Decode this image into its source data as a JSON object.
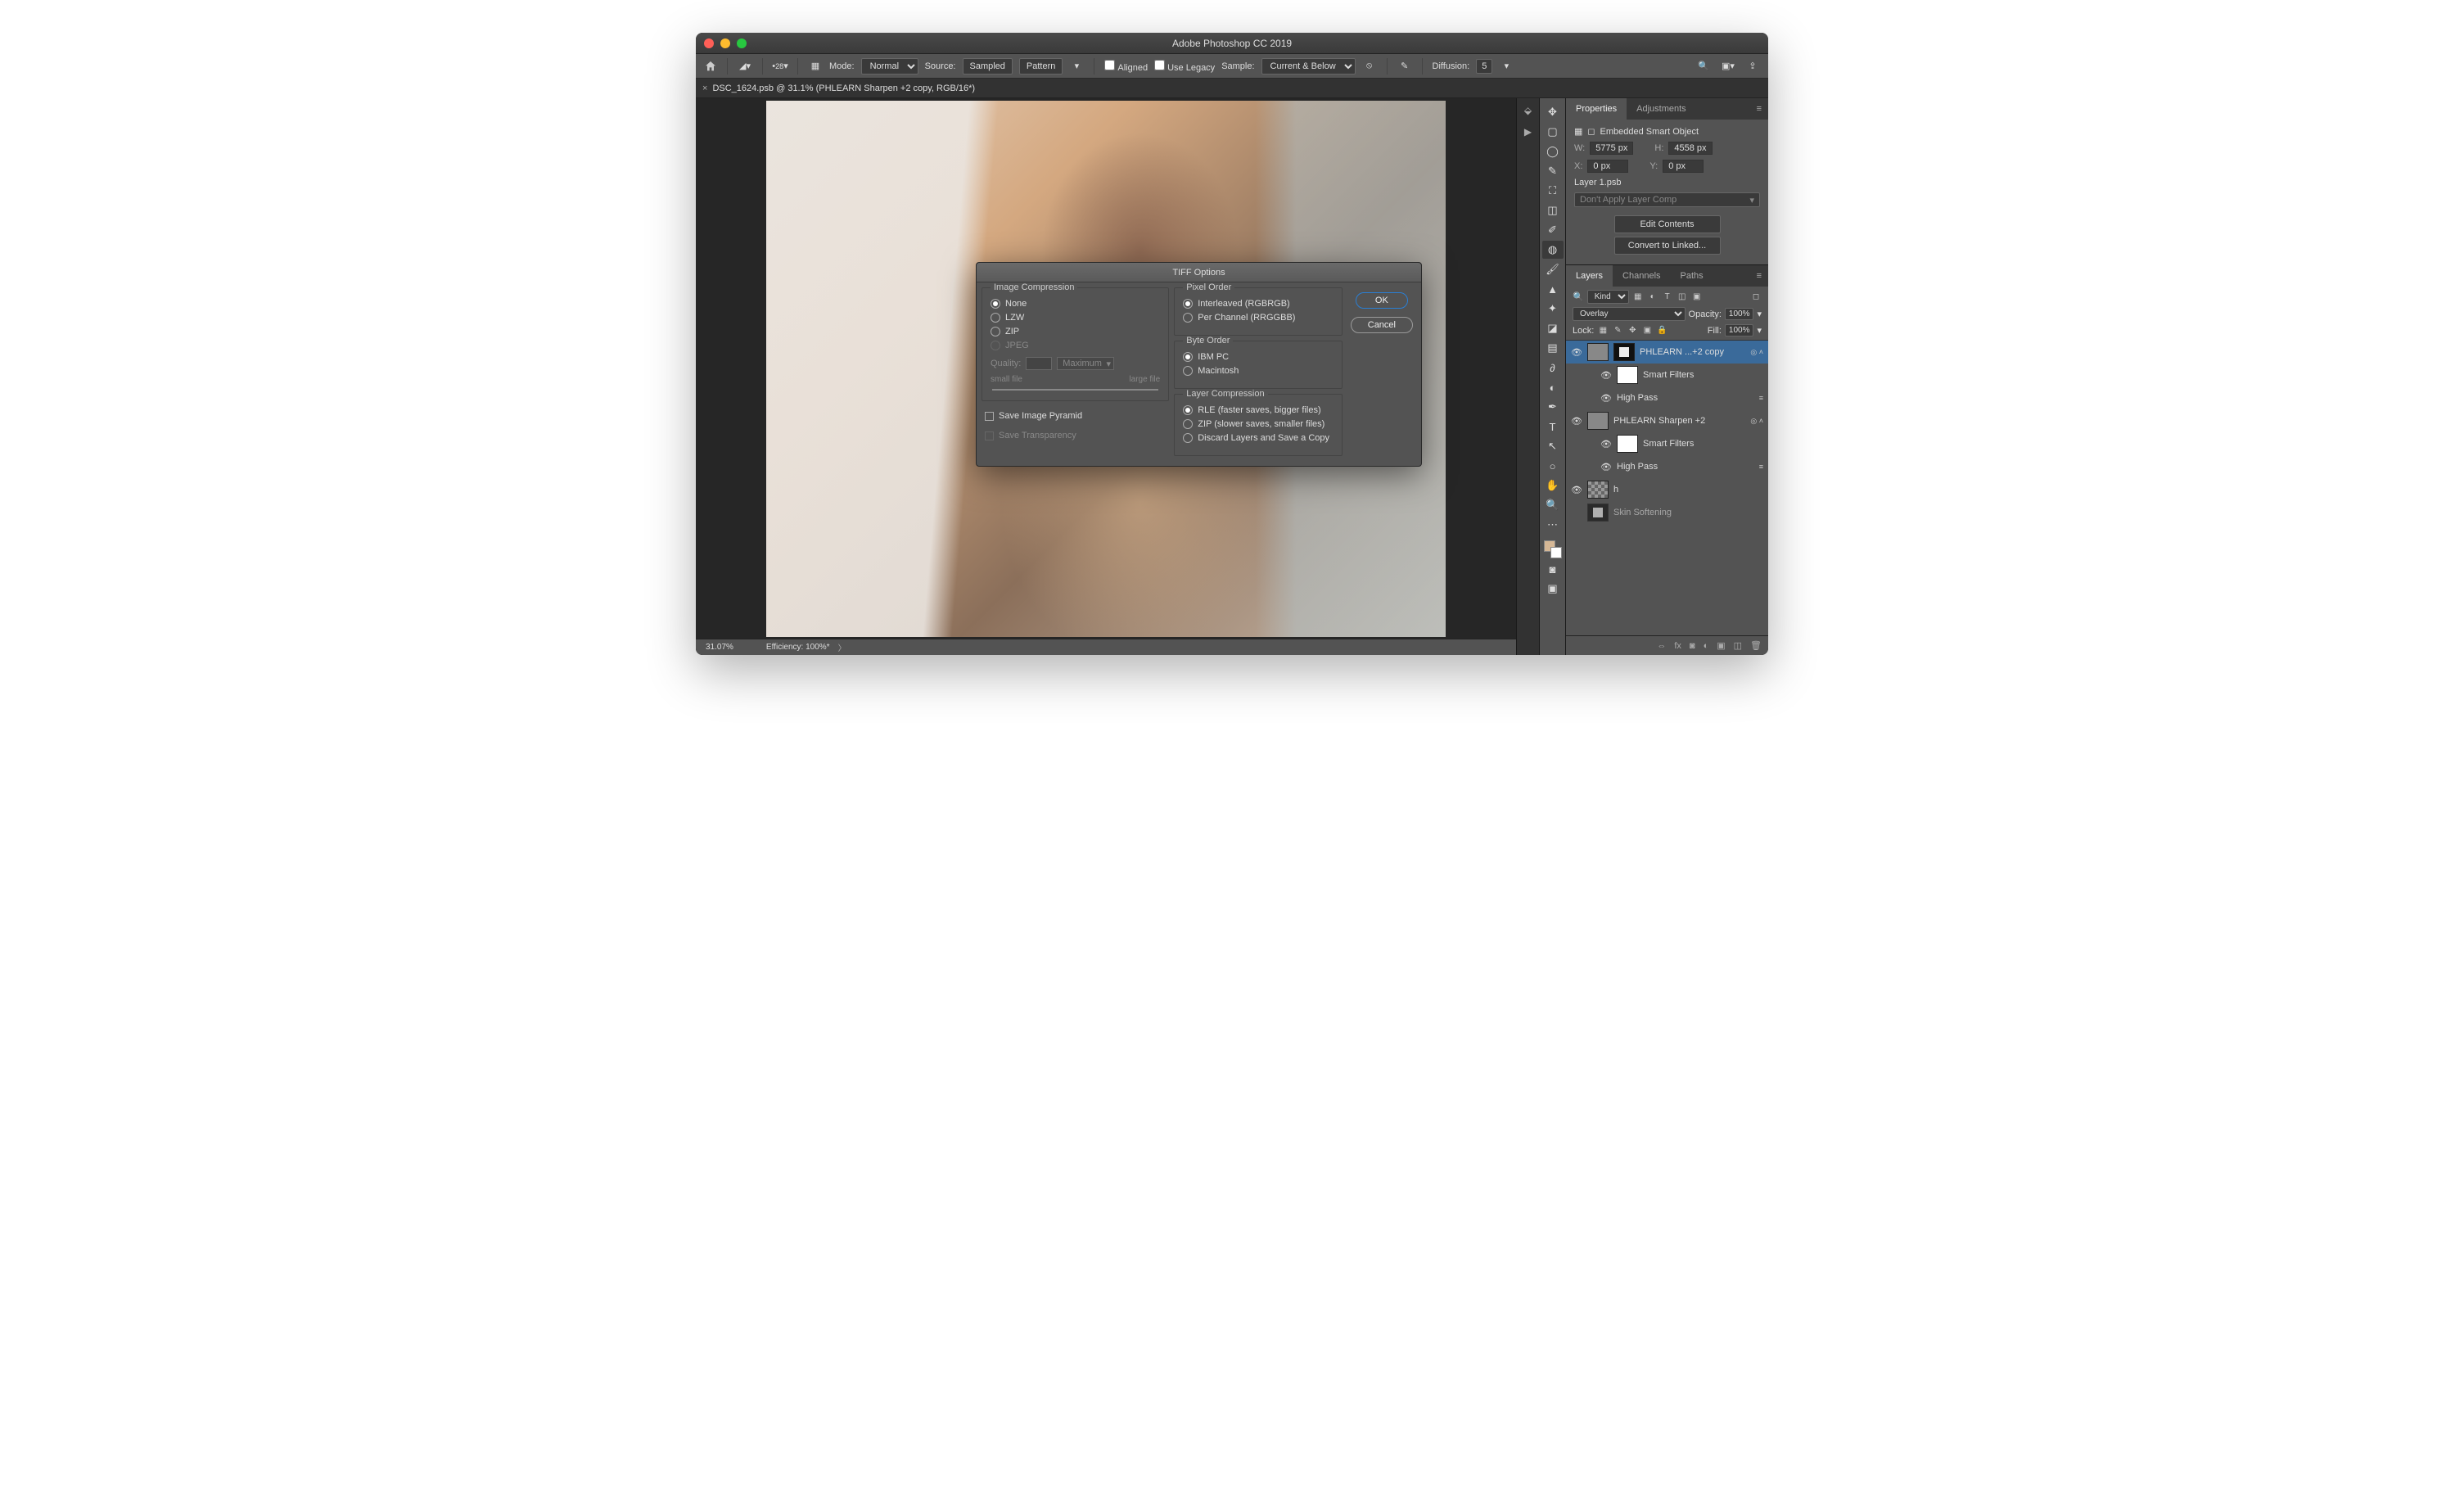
{
  "title": "Adobe Photoshop CC 2019",
  "options_bar": {
    "brush_size": "28",
    "mode_label": "Mode:",
    "mode_value": "Normal",
    "source_label": "Source:",
    "sampled": "Sampled",
    "pattern": "Pattern",
    "aligned": "Aligned",
    "use_legacy": "Use Legacy",
    "sample_label": "Sample:",
    "sample_value": "Current & Below",
    "diffusion_label": "Diffusion:",
    "diffusion_value": "5"
  },
  "tab": {
    "name": "DSC_1624.psb @ 31.1% (PHLEARN Sharpen +2 copy, RGB/16*)"
  },
  "status": {
    "zoom": "31.07%",
    "efficiency": "Efficiency: 100%*"
  },
  "properties": {
    "tab_properties": "Properties",
    "tab_adjustments": "Adjustments",
    "type": "Embedded Smart Object",
    "w_label": "W:",
    "w_val": "5775 px",
    "h_label": "H:",
    "h_val": "4558 px",
    "x_label": "X:",
    "x_val": "0 px",
    "y_label": "Y:",
    "y_val": "0 px",
    "source": "Layer 1.psb",
    "comp": "Don't Apply Layer Comp",
    "edit": "Edit Contents",
    "convert": "Convert to Linked..."
  },
  "layers_panel": {
    "tab_layers": "Layers",
    "tab_channels": "Channels",
    "tab_paths": "Paths",
    "kind": "Kind",
    "blend": "Overlay",
    "opacity_label": "Opacity:",
    "opacity_value": "100%",
    "lock_label": "Lock:",
    "fill_label": "Fill:",
    "fill_value": "100%",
    "layers": [
      {
        "name": "PHLEARN ...+2 copy",
        "sel": true
      },
      {
        "name": "Smart Filters",
        "indent": true
      },
      {
        "name": "High Pass",
        "indent": true,
        "sub": true
      },
      {
        "name": "PHLEARN Sharpen +2"
      },
      {
        "name": "Smart Filters",
        "indent": true
      },
      {
        "name": "High Pass",
        "indent": true,
        "sub": true
      },
      {
        "name": "h",
        "checker": true
      },
      {
        "name": "Skin Softening",
        "cut": true
      }
    ]
  },
  "dialog": {
    "title": "TIFF Options",
    "image_compression": {
      "legend": "Image Compression",
      "none": "None",
      "lzw": "LZW",
      "zip": "ZIP",
      "jpeg": "JPEG",
      "quality_label": "Quality:",
      "quality_preset": "Maximum",
      "small": "small file",
      "large": "large file"
    },
    "save_pyramid": "Save Image Pyramid",
    "save_transparency": "Save Transparency",
    "pixel_order": {
      "legend": "Pixel Order",
      "interleaved": "Interleaved (RGBRGB)",
      "per_channel": "Per Channel (RRGGBB)"
    },
    "byte_order": {
      "legend": "Byte Order",
      "ibm": "IBM PC",
      "mac": "Macintosh"
    },
    "layer_compression": {
      "legend": "Layer Compression",
      "rle": "RLE (faster saves, bigger files)",
      "zip": "ZIP (slower saves, smaller files)",
      "discard": "Discard Layers and Save a Copy"
    },
    "ok": "OK",
    "cancel": "Cancel"
  }
}
